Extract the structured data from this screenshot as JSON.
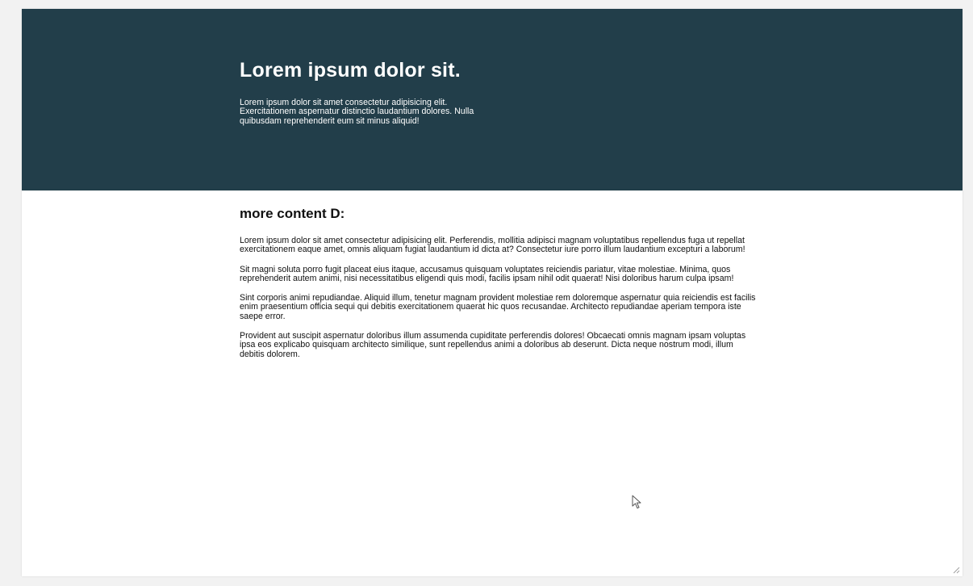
{
  "hero": {
    "title": "Lorem ipsum dolor sit.",
    "text": "Lorem ipsum dolor sit amet consectetur adipisicing elit. Exercitationem aspernatur distinctio laudantium dolores. Nulla quibusdam reprehenderit eum sit minus aliquid!"
  },
  "main": {
    "heading": "more content D:",
    "paragraphs": [
      "Lorem ipsum dolor sit amet consectetur adipisicing elit. Perferendis, mollitia adipisci magnam voluptatibus repellendus fuga ut repellat exercitationem eaque amet, omnis aliquam fugiat laudantium id dicta at? Consectetur iure porro illum laudantium excepturi a laborum!",
      "Sit magni soluta porro fugit placeat eius itaque, accusamus quisquam voluptates reiciendis pariatur, vitae molestiae. Minima, quos reprehenderit autem animi, nisi necessitatibus eligendi quis modi, facilis ipsam nihil odit quaerat! Nisi doloribus harum culpa ipsam!",
      "Sint corporis animi repudiandae. Aliquid illum, tenetur magnam provident molestiae rem doloremque aspernatur quia reiciendis est facilis enim praesentium officia sequi qui debitis exercitationem quaerat hic quos recusandae. Architecto repudiandae aperiam tempora iste saepe error.",
      "Provident aut suscipit aspernatur doloribus illum assumenda cupiditate perferendis dolores! Obcaecati omnis magnam ipsam voluptas ipsa eos explicabo quisquam architecto similique, sunt repellendus animi a doloribus ab deserunt. Dicta neque nostrum modi, illum debitis dolorem."
    ]
  },
  "colors": {
    "hero_background": "#223e4a",
    "page_background": "#ffffff",
    "outer_background": "#f2f2f2",
    "hero_text": "#ffffff",
    "body_text": "#111111"
  },
  "icons": {
    "cursor": "mouse-cursor-icon",
    "resize": "resize-grip-icon"
  }
}
